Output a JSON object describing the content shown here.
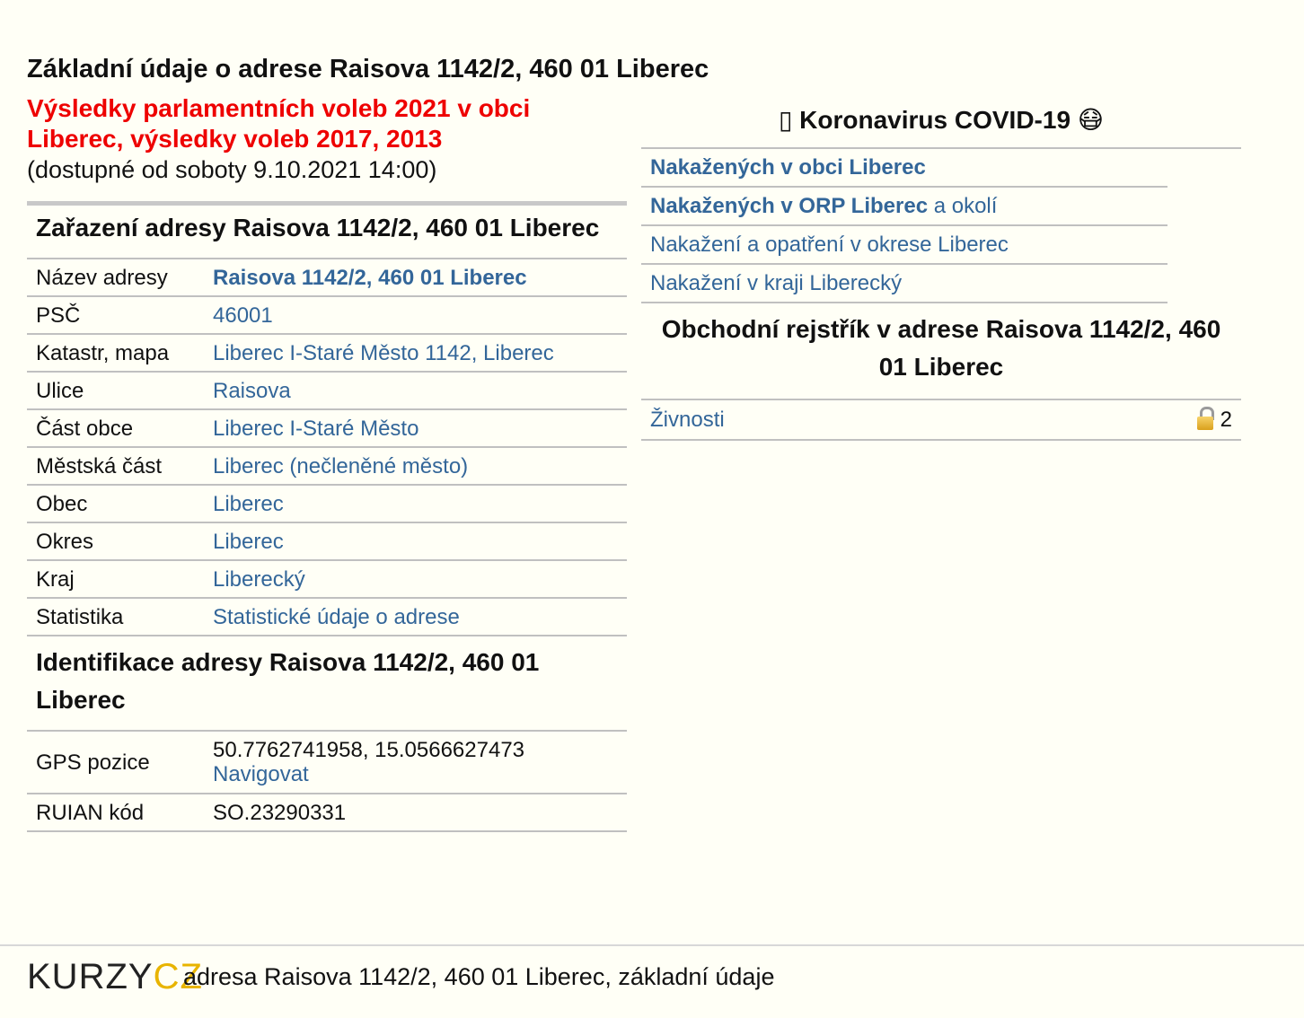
{
  "page_title": "Základní údaje o adrese Raisova 1142/2, 460 01 Liberec",
  "elections": {
    "link": "Výsledky parlamentních voleb 2021 v obci Liberec, výsledky voleb 2017, 2013",
    "note": "(dostupné od soboty 9.10.2021 14:00)"
  },
  "assignment": {
    "heading": "Zařazení adresy Raisova 1142/2, 460 01 Liberec",
    "rows": [
      {
        "label": "Název adresy",
        "value": "Raisova 1142/2, 460 01 Liberec"
      },
      {
        "label": "PSČ",
        "value": "46001"
      },
      {
        "label": "Katastr, mapa",
        "value": "Liberec I-Staré Město 1142, Liberec"
      },
      {
        "label": "Ulice",
        "value": "Raisova"
      },
      {
        "label": "Část obce",
        "value": "Liberec I-Staré Město"
      },
      {
        "label": "Městská část",
        "value": "Liberec (nečleněné město)"
      },
      {
        "label": "Obec",
        "value": "Liberec"
      },
      {
        "label": "Okres",
        "value": "Liberec"
      },
      {
        "label": "Kraj",
        "value": "Liberecký"
      },
      {
        "label": "Statistika",
        "value": "Statistické údaje o adrese"
      }
    ]
  },
  "identification": {
    "heading": "Identifikace adresy Raisova 1142/2, 460 01 Liberec",
    "gps_label": "GPS pozice",
    "gps_value": "50.7762741958, 15.0566627473",
    "navigate_label": "Navigovat",
    "ruian_label": "RUIAN kód",
    "ruian_value": "SO.23290331"
  },
  "covid": {
    "title": "Koronavirus COVID-19",
    "title_icon": "▯",
    "mask_icon": "😷",
    "items": [
      {
        "bold": "Nakažených v obci Liberec",
        "rest": ""
      },
      {
        "bold": "Nakažených v ORP Liberec",
        "rest": " a okolí"
      },
      {
        "bold": "",
        "rest": "Nakažení a opatření v okrese Liberec"
      },
      {
        "bold": "",
        "rest": "Nakažení v kraji Liberecký"
      }
    ]
  },
  "registry": {
    "title": "Obchodní rejstřík v adrese Raisova 1142/2, 460 01 Liberec",
    "trade_label": "Živnosti",
    "trade_count": "2",
    "lock_icon": "lock-icon"
  },
  "footer": {
    "logo_part1": "KURZY",
    "logo_part2": "CZ",
    "text": "adresa Raisova 1142/2, 460 01 Liberec, základní údaje"
  },
  "colors": {
    "link": "#336699",
    "election_red": "#ee0000",
    "background": "#fffff6",
    "logo_yellow": "#e8b400"
  }
}
